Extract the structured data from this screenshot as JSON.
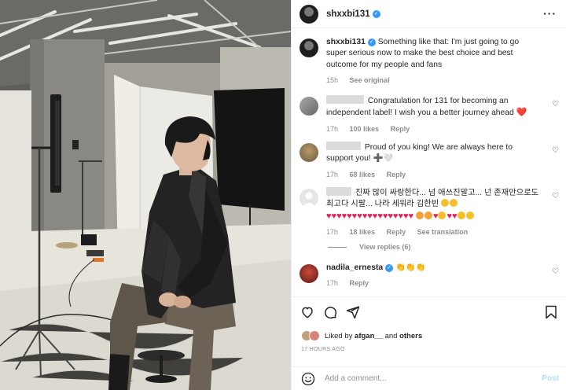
{
  "header": {
    "username": "shxxbi131",
    "verified": true,
    "more_icon": "more-horizontal-icon"
  },
  "caption": {
    "username": "shxxbi131",
    "text": "Something like that: I'm just going to go super serious now to make the best choice and best outcome for my people and fans",
    "time": "15h",
    "see_original": "See original"
  },
  "comments": [
    {
      "text": "Congratulation for 131 for becoming an independent label! I wish you a better journey ahead",
      "emoji": "❤️",
      "time": "17h",
      "likes": "100 likes",
      "reply": "Reply"
    },
    {
      "text": "Proud of you king! We are always here to support you!",
      "emoji": "➕🤍",
      "time": "17h",
      "likes": "68 likes",
      "reply": "Reply"
    },
    {
      "text": "진짜 많이 싸랑한다... 넘 애쓰진말고... 넌 존재만으로도 최고다 시팔... 나라 세워라 김한빈",
      "time": "17h",
      "likes": "18 likes",
      "reply": "Reply",
      "translation": "See translation",
      "view_replies": "View replies (6)"
    },
    {
      "username": "nadila_ernesta",
      "verified": true,
      "text": "👏👏👏",
      "time": "17h",
      "reply": "Reply"
    }
  ],
  "actions": {
    "liked_prefix": "Liked by",
    "liked_user": "afgan__",
    "liked_and": "and",
    "liked_others": "others",
    "time_ago": "17 HOURS AGO"
  },
  "comment_box": {
    "placeholder": "Add a comment...",
    "post_label": "Post"
  }
}
